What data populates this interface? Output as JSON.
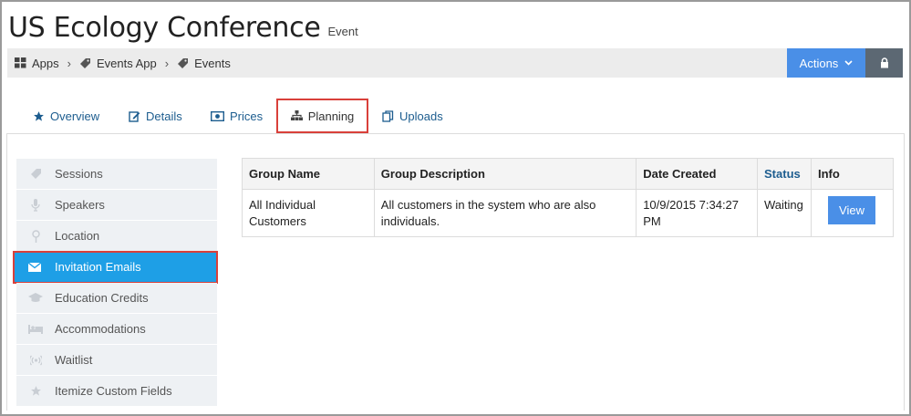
{
  "header": {
    "title": "US Ecology Conference",
    "subtitle": "Event"
  },
  "breadcrumb": [
    {
      "label": "Apps",
      "icon": "grid-icon"
    },
    {
      "label": "Events App",
      "icon": "tag-icon"
    },
    {
      "label": "Events",
      "icon": "tag-icon"
    }
  ],
  "toolbar": {
    "actions_label": "Actions",
    "actions_icon": "chevron-down-icon",
    "lock_icon": "lock-icon"
  },
  "tabs": [
    {
      "label": "Overview",
      "icon": "star-icon"
    },
    {
      "label": "Details",
      "icon": "edit-icon"
    },
    {
      "label": "Prices",
      "icon": "money-icon"
    },
    {
      "label": "Planning",
      "icon": "sitemap-icon",
      "active": true
    },
    {
      "label": "Uploads",
      "icon": "copy-icon"
    }
  ],
  "sidebar": {
    "items": [
      {
        "label": "Sessions",
        "icon": "tag-icon"
      },
      {
        "label": "Speakers",
        "icon": "microphone-icon"
      },
      {
        "label": "Location",
        "icon": "map-pin-icon"
      },
      {
        "label": "Invitation Emails",
        "icon": "envelope-icon",
        "active": true
      },
      {
        "label": "Education Credits",
        "icon": "graduation-cap-icon"
      },
      {
        "label": "Accommodations",
        "icon": "bed-icon"
      },
      {
        "label": "Waitlist",
        "icon": "signal-icon"
      },
      {
        "label": "Itemize Custom Fields",
        "icon": "star-icon"
      }
    ]
  },
  "table": {
    "headers": [
      "Group Name",
      "Group Description",
      "Date Created",
      "Status",
      "Info"
    ],
    "rows": [
      {
        "group_name": "All Individual Customers",
        "description": "All customers in the system who are also individuals.",
        "date_created": "10/9/2015 7:34:27 PM",
        "status": "Waiting",
        "info_button": "View"
      }
    ]
  },
  "colors": {
    "accent": "#4a8fe7",
    "active_nav": "#1e9fe6",
    "highlight_border": "#d9403a",
    "link": "#1d5d8f"
  }
}
